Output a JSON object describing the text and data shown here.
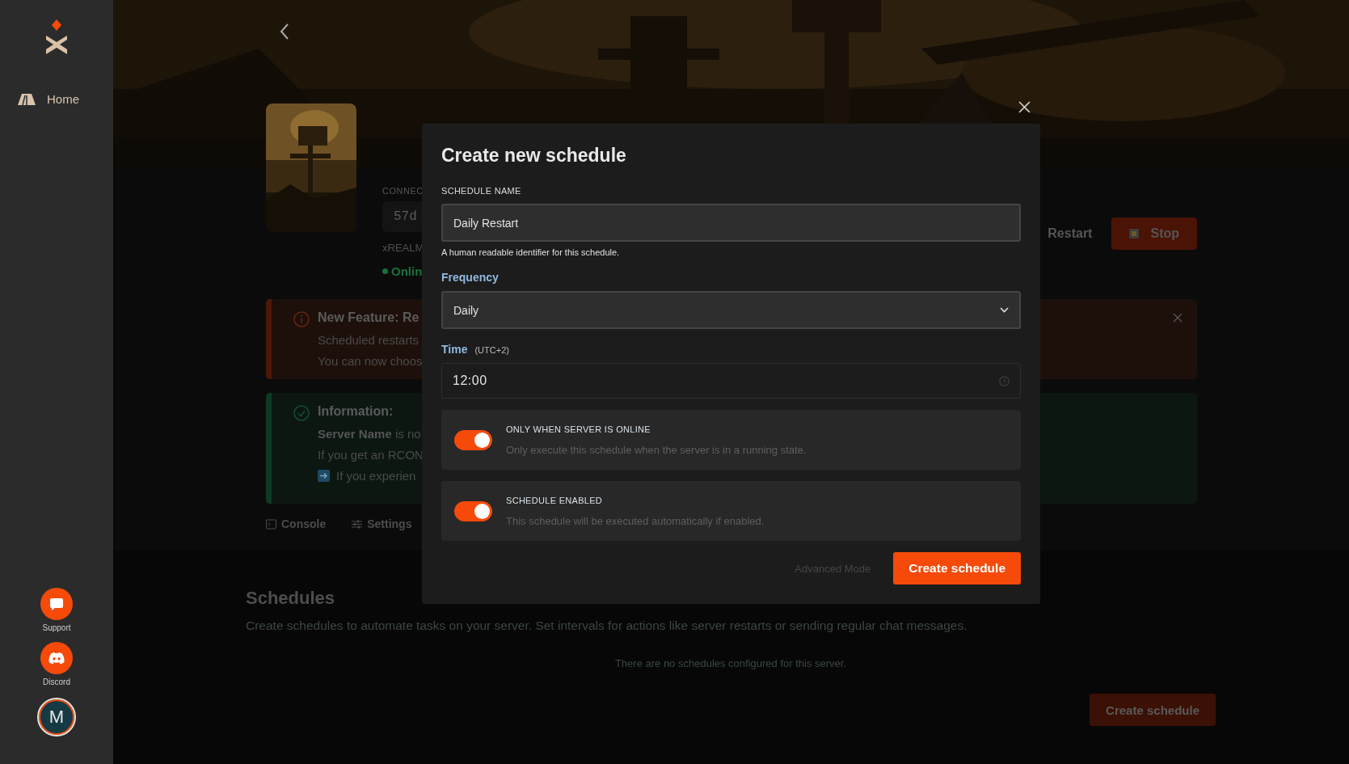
{
  "sidebar": {
    "nav": [
      {
        "label": "Home"
      }
    ],
    "links": [
      {
        "label": "Support",
        "kind": "chat"
      },
      {
        "label": "Discord",
        "kind": "discord"
      }
    ],
    "avatar": "M"
  },
  "server": {
    "connection_label": "CONNEC",
    "connection_value": "57d",
    "name": "xREALM",
    "status": "Onlin"
  },
  "actions": [
    {
      "label": "Restart",
      "kind": "plain"
    },
    {
      "label": "Stop",
      "kind": "danger"
    }
  ],
  "alerts": [
    {
      "kind": "warning",
      "title": "New Feature: Re",
      "dismissible": true,
      "lines": [
        {
          "kind": "text",
          "text": "Scheduled restarts"
        },
        {
          "kind": "text",
          "text": "You can now choos"
        }
      ]
    },
    {
      "kind": "info",
      "title": "Information:",
      "dismissible": false,
      "lines": [
        {
          "kind": "text",
          "text": "**Server Name** is no"
        },
        {
          "kind": "text",
          "text": "If you get an RCON"
        },
        {
          "kind": "arrow",
          "text": "If you experien"
        }
      ]
    }
  ],
  "tabs": [
    {
      "label": "Console",
      "kind": "console"
    },
    {
      "label": "Settings",
      "kind": "settings"
    }
  ],
  "schedules": {
    "title": "Schedules",
    "description": "Create schedules to automate tasks on your server. Set intervals for actions like server restarts or sending regular chat messages.",
    "empty": "There are no schedules configured for this server.",
    "button": "Create schedule"
  },
  "modal": {
    "title": "Create new schedule",
    "name_label": "SCHEDULE NAME",
    "name_value": "Daily Restart",
    "name_hint": "A human readable identifier for this schedule.",
    "frequency_label": "Frequency",
    "frequency_value": "Daily",
    "time_label": "Time",
    "time_zone": "(UTC+2)",
    "time_value": "12:00",
    "toggles": [
      {
        "title": "ONLY WHEN SERVER IS ONLINE",
        "description": "Only execute this schedule when the server is in a running state.",
        "on": true
      },
      {
        "title": "SCHEDULE ENABLED",
        "description": "This schedule will be executed automatically if enabled.",
        "on": true
      }
    ],
    "secondary": "Advanced Mode",
    "submit": "Create schedule"
  }
}
